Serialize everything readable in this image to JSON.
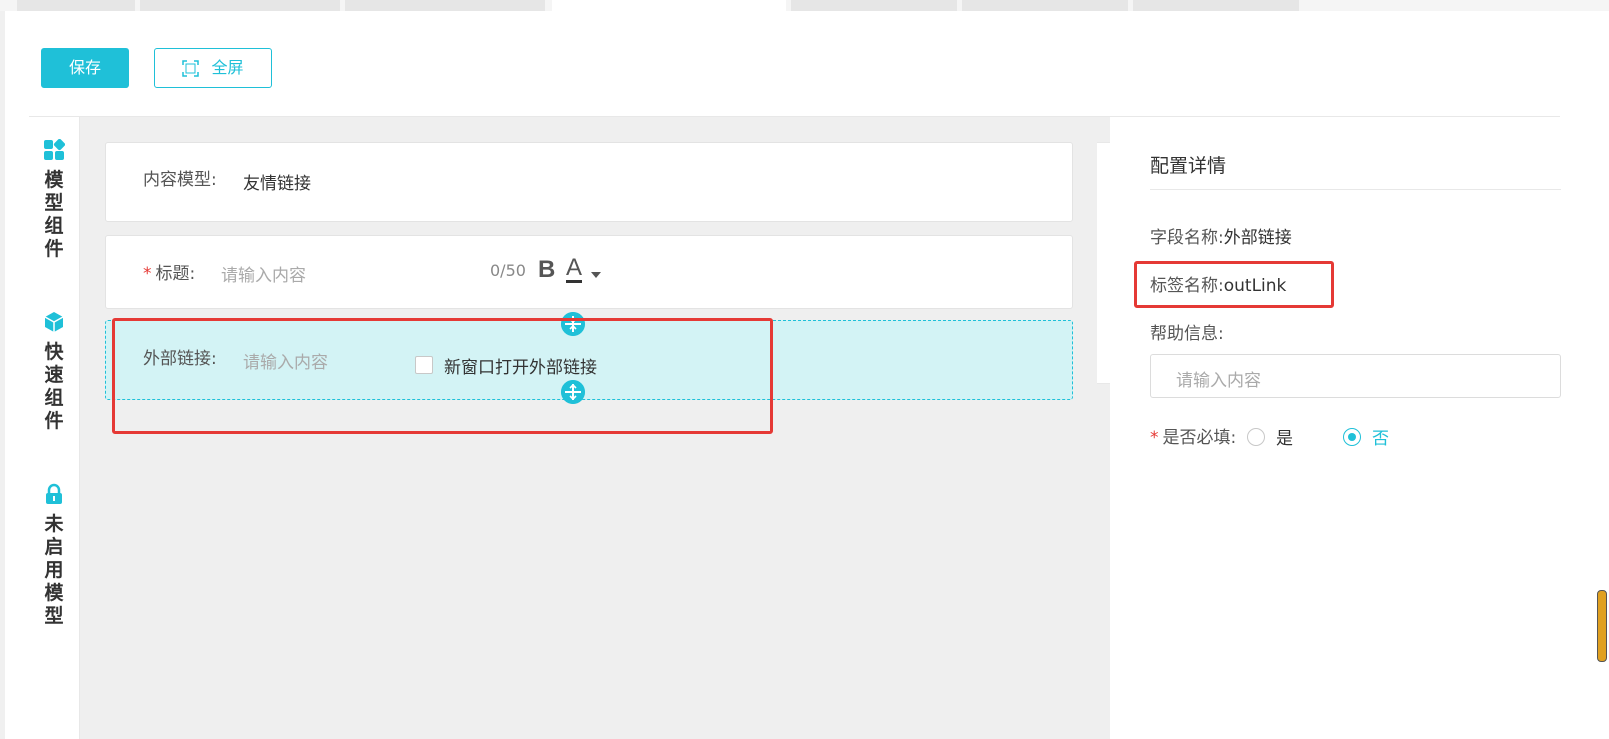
{
  "toolbar": {
    "save_label": "保存",
    "fullscreen_label": "全屏"
  },
  "sidebar": {
    "groups": [
      {
        "label": "模型组件",
        "icon": "grid-icon"
      },
      {
        "label": "快速组件",
        "icon": "cube-icon"
      },
      {
        "label": "未启用模型",
        "icon": "lock-icon"
      }
    ]
  },
  "form": {
    "content_model": {
      "label": "内容模型:",
      "value": "友情链接"
    },
    "title": {
      "required_mark": "*",
      "label": "标题:",
      "placeholder": "请输入内容",
      "counter": "0/50",
      "bold": "B",
      "font": "A"
    },
    "external_link": {
      "label": "外部链接:",
      "placeholder": "请输入内容",
      "checkbox_label": "新窗口打开外部链接"
    }
  },
  "config": {
    "title": "配置详情",
    "field_name_label": "字段名称:",
    "field_name_value": "外部链接",
    "tag_name_label": "标签名称:",
    "tag_name_value": "outLink",
    "help_label": "帮助信息:",
    "help_placeholder": "请输入内容",
    "required_mark": "*",
    "required_label": "是否必填:",
    "option_yes": "是",
    "option_no": "否",
    "selected": "否"
  },
  "colors": {
    "accent": "#1fc0d8",
    "highlight": "#e53935",
    "selected_bg": "#d3f3f5"
  }
}
